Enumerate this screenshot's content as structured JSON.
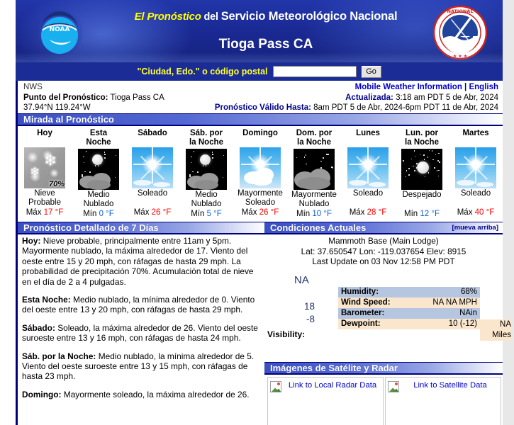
{
  "banner": {
    "title_prefix": "El Pronóstico",
    "title_del": " del ",
    "title_main": "Servicio Meteorológico Nacional",
    "location": "Tioga Pass CA",
    "noaa_logo_alt": "NOAA",
    "nws_logo_alt": "National Weather Service"
  },
  "search": {
    "label": "\"Ciudad, Edo.\" o código postal",
    "value": "",
    "placeholder": "",
    "go_label": "Go"
  },
  "info": {
    "agency": "NWS",
    "point_label": "Punto del Pronóstico:",
    "point_value": "Tioga Pass CA",
    "coords": "37.94°N 119.24°W",
    "mobile_link": "Mobile Weather Information",
    "separator": "|",
    "english_link": "English",
    "updated_label": "Actualizada:",
    "updated_value": "3:18 am PDT 5 de Abr, 2024",
    "valid_label": "Pronóstico Válido Hasta:",
    "valid_value": "8am PDT 5 de Abr, 2024-6pm PDT 11 de Abr, 2024"
  },
  "forecast_overview": {
    "header": "Mirada al Pronóstico",
    "columns": [
      {
        "day": "Hoy",
        "icon": "snow-likely-icon",
        "pop": "70%",
        "condition": "Nieve\nProbable",
        "temp_label": "Máx",
        "temp_value": "17 °F",
        "temp_kind": "high"
      },
      {
        "day": "Esta\nNoche",
        "icon": "partly-cloudy-night-icon",
        "pop": "",
        "condition": "Medio\nNublado",
        "temp_label": "Mín",
        "temp_value": "0 °F",
        "temp_kind": "low"
      },
      {
        "day": "Sábado",
        "icon": "sunny-icon",
        "pop": "",
        "condition": "Soleado",
        "temp_label": "Máx",
        "temp_value": "26 °F",
        "temp_kind": "high"
      },
      {
        "day": "Sáb. por\nla Noche",
        "icon": "partly-cloudy-night-icon",
        "pop": "",
        "condition": "Medio\nNublado",
        "temp_label": "Mín",
        "temp_value": "5 °F",
        "temp_kind": "low"
      },
      {
        "day": "Domingo",
        "icon": "mostly-sunny-icon",
        "pop": "",
        "condition": "Mayormente\nSoleado",
        "temp_label": "Máx",
        "temp_value": "26 °F",
        "temp_kind": "high"
      },
      {
        "day": "Dom. por\nla Noche",
        "icon": "mostly-cloudy-night-icon",
        "pop": "",
        "condition": "Mayormente\nNublado",
        "temp_label": "Mín",
        "temp_value": "10 °F",
        "temp_kind": "low"
      },
      {
        "day": "Lunes",
        "icon": "sunny-icon",
        "pop": "",
        "condition": "Soleado",
        "temp_label": "Máx",
        "temp_value": "28 °F",
        "temp_kind": "high"
      },
      {
        "day": "Lun. por\nla Noche",
        "icon": "clear-night-icon",
        "pop": "",
        "condition": "Despejado",
        "temp_label": "Mín",
        "temp_value": "12 °F",
        "temp_kind": "low"
      },
      {
        "day": "Martes",
        "icon": "sunny-icon",
        "pop": "",
        "condition": "Soleado",
        "temp_label": "Máx",
        "temp_value": "40 °F",
        "temp_kind": "high"
      }
    ]
  },
  "detailed": {
    "header": "Pronóstico Detallado de 7 Días",
    "periods": [
      {
        "label": "Hoy:",
        "text": " Nieve probable, principalmente entre 11am y 5pm. Mayormente nublado, la máxima alrededor de 17. Viento del oeste entre 15 y 20 mph, con ráfagas de hasta 29 mph. La probabilidad de precipitación 70%. Acumulación total de nieve en el día de 2 a 4 pulgadas."
      },
      {
        "label": "Esta Noche:",
        "text": " Medio nublado, la mínima alrededor de 0. Viento del oeste entre 13 y 20 mph, con ráfagas de hasta 29 mph."
      },
      {
        "label": "Sábado:",
        "text": " Soleado, la máxima alrededor de 26. Viento del oeste suroeste entre 13 y 16 mph, con ráfagas de hasta 24 mph."
      },
      {
        "label": "Sáb. por la Noche:",
        "text": " Medio nublado, la mínima alrededor de 5. Viento del oeste suroeste entre 13 y 15 mph, con ráfagas de hasta 23 mph."
      },
      {
        "label": "Domingo:",
        "text": " Mayormente soleado, la máxima alrededor de 26."
      }
    ]
  },
  "current": {
    "header": "Condiciones Actuales",
    "move_up": "[mueva arriba]",
    "station": "Mammoth Base (Main Lodge)",
    "latlon": "Lat: 37.650547 Lon: -119.037654 Elev: 8915",
    "last_update": "Last Update on 03 Nov 12:58 PM PDT",
    "weather": "NA",
    "temp_f": "18",
    "temp_c": "-8",
    "visibility_label": "Visibility:",
    "visibility_value": "NA",
    "visibility_unit": "Miles",
    "rows": [
      {
        "key": "Humidity:",
        "value": "68%"
      },
      {
        "key": "Wind Speed:",
        "value": "NA NA MPH"
      },
      {
        "key": "Barometer:",
        "value": "NAin"
      },
      {
        "key": "Dewpoint:",
        "value": "10 (-12)"
      }
    ]
  },
  "satellite": {
    "header": "Imágenes de Satélite y Radar",
    "items": [
      {
        "label": "Link to Local Radar Data"
      },
      {
        "label": "Link to Satellite Data"
      }
    ]
  },
  "colors": {
    "banner_blue": "#1b2fa0",
    "search_blue": "#1b2c96",
    "header_dark": "#00007a",
    "link_blue": "#0000cc",
    "high_red": "#ff0000",
    "low_blue": "#0b5fd0",
    "row_alt1": "#b6c6e0",
    "row_alt2": "#fae6cc",
    "yellow": "#ffff00"
  }
}
